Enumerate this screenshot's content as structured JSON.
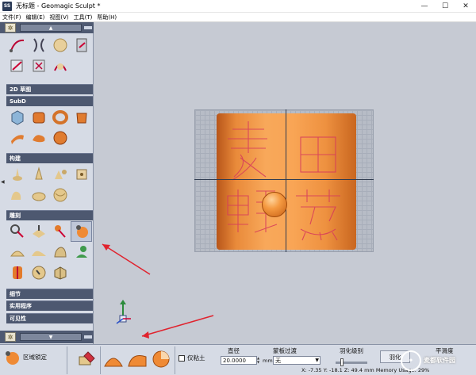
{
  "window": {
    "app_icon": "SS",
    "title": "无标题 - Geomagic Sculpt *",
    "controls": {
      "minimize": "—",
      "maximize": "☐",
      "close": "✕"
    }
  },
  "menu": [
    "文件(F)",
    "编辑(E)",
    "视图(V)",
    "工具(T)",
    "帮助(H)"
  ],
  "sidebar": {
    "sections": [
      "2D 草图",
      "SubD",
      "构建",
      "雕刻",
      "细节",
      "实用程序",
      "可见性"
    ]
  },
  "bottom_bar": {
    "active_tool": "区域锁定",
    "mask_checkbox": "仅粘土",
    "diameter_label": "直径",
    "diameter_value": "20.0000",
    "diameter_unit": "mm",
    "mask_transition_label": "蒙板过渡",
    "mask_transition_value": "无",
    "feather_level_label": "羽化级别",
    "feather_button": "羽化",
    "smoothness_label": "平滑度",
    "status": "X: -7.35   Y: -18.1   Z: 49.4   mm   Memory Usage: 29%"
  },
  "watermark": "麦都软件园",
  "colors": {
    "panel_header": "#4d5870",
    "clay": "#f39a45",
    "viewport": "#c6cad3"
  }
}
